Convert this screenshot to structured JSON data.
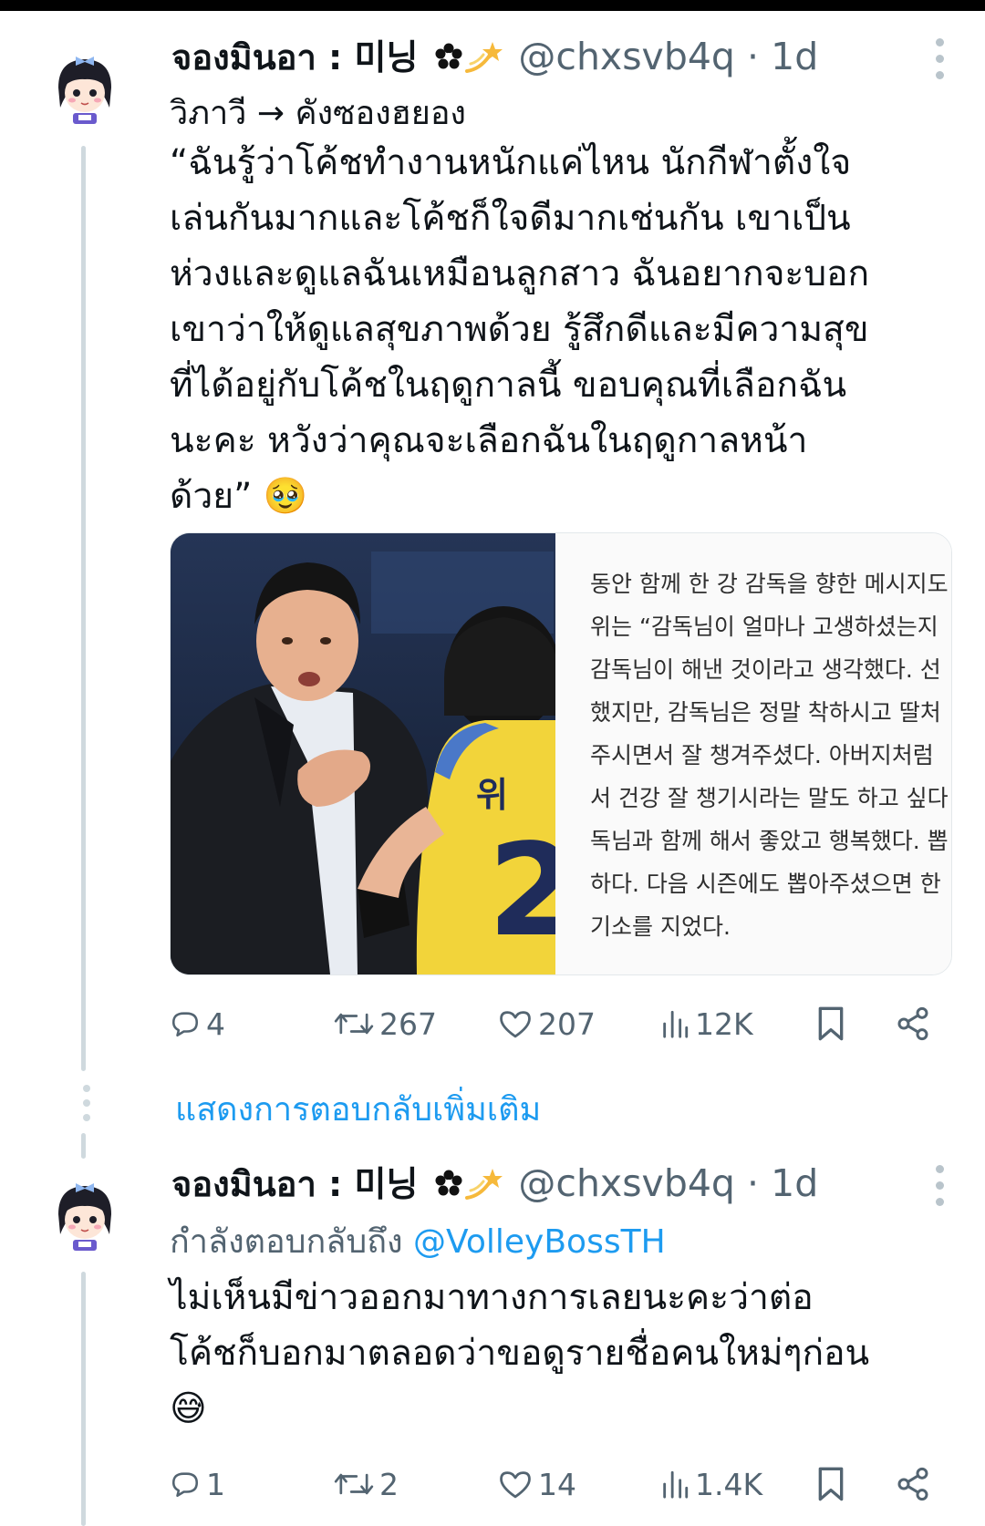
{
  "tweet1": {
    "display_name": "จองมินอา : 미닝",
    "handle": "@chxsvb4q",
    "separator": "·",
    "time": "1d",
    "subline_from": "วิภาวี",
    "subline_arrow": "→",
    "subline_to": "คังซองฮยอง",
    "body_lines": [
      "“ฉันรู้ว่าโค้ชทำงานหนักแค่ไหน นักกีฬาตั้งใจ",
      "เล่นกันมากและโค้ชก็ใจดีมากเช่นกัน เขาเป็น",
      "ห่วงและดูแลฉันเหมือนลูกสาว ฉันอยากจะบอก",
      "เขาว่าให้ดูแลสุขภาพด้วย รู้สึกดีและมีความสุข",
      "ที่ได้อยู่กับโค้ชในฤดูกาลนี้ ขอบคุณที่เลือกฉัน",
      "นะคะ หวังว่าคุณจะเลือกฉันในฤดูกาลหน้า",
      "ด้วย”"
    ],
    "body_emoji": "🥹",
    "card": {
      "lines": [
        "동안 함께 한 강 감독을 향한 메시지도",
        "위는 “감독님이 얼마나 고생하셨는지",
        "감독님이 해낸 것이라고 생각했다. 선",
        "했지만, 감독님은 정말 착하시고 딸처",
        "주시면서 잘 챙겨주셨다. 아버지처럼",
        "서 건강 잘 챙기시라는 말도 하고 싶다",
        "독님과 함께 해서 좋았고 행복했다. 뽑",
        "하다. 다음 시즌에도 뽑아주셨으면 한",
        "기소를 지었다."
      ]
    },
    "actions": {
      "replies": "4",
      "reposts": "267",
      "likes": "207",
      "views": "12K"
    }
  },
  "show_more_replies": "แสดงการตอบกลับเพิ่มเติม",
  "tweet2": {
    "display_name": "จองมินอา : 미닝",
    "handle": "@chxsvb4q",
    "separator": "·",
    "time": "1d",
    "replying_to_label": "กำลังตอบกลับถึง",
    "replying_to_handle": "@VolleyBossTH",
    "body_lines": [
      "ไม่เห็นมีข่าวออกมาทางการเลยนะคะว่าต่อ",
      "โค้ชก็บอกมาตลอดว่าขอดูรายชื่อคนใหม่ๆก่อน"
    ],
    "body_emoji": "😅",
    "actions": {
      "replies": "1",
      "reposts": "2",
      "likes": "14",
      "views": "1.4K"
    }
  },
  "icons": {
    "name_decoration_1": "flower-icon",
    "name_decoration_2": "dizzy-star-icon",
    "reply": "reply-bubble-icon",
    "repost": "repost-icon",
    "like": "heart-icon",
    "views": "views-bar-chart-icon",
    "bookmark": "bookmark-icon",
    "share": "share-icon",
    "more": "more-vertical-icon"
  },
  "colors": {
    "text": "#0f1419",
    "muted": "#536471",
    "link": "#1d9bf0",
    "thread_line": "#cfd9de",
    "jersey_yellow": "#f2d43a"
  }
}
